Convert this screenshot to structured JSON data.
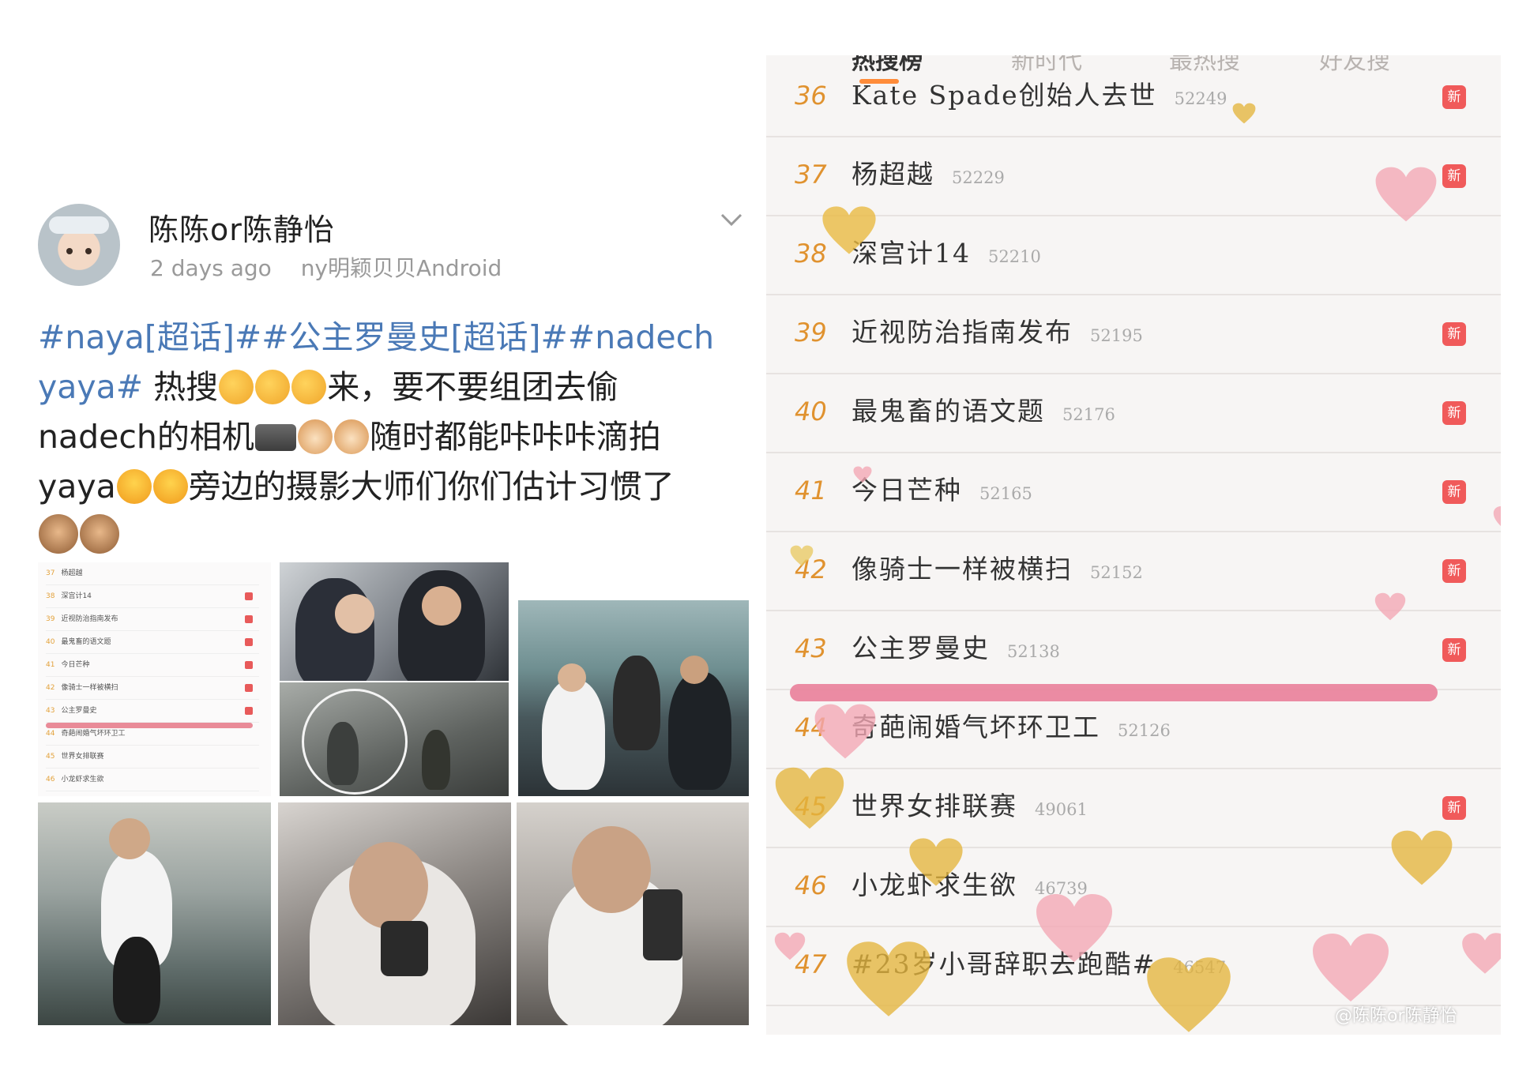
{
  "post": {
    "username": "陈陈or陈静怡",
    "time": "2 days ago",
    "source": "ny明颖贝贝Android",
    "tags": {
      "t1": "#naya[超话]#",
      "t2": "#公主罗曼史[超话]#",
      "t3": "#nadech",
      "t3b": "yaya#"
    },
    "text": {
      "a": " 热搜",
      "b": "来，要不要组团去偷",
      "c": "nadech的相机",
      "d": "随时都能咔咔咔滴拍",
      "e": "yaya",
      "f": "旁边的摄影大师们你们估计习惯了"
    },
    "emoji": [
      "clap-emoji",
      "camera-emoji",
      "cat-emoji",
      "laugh-emoji",
      "see-no-evil-monkey-emoji"
    ],
    "thumbnail_list": [
      {
        "rank": "37",
        "title": "杨超越"
      },
      {
        "rank": "38",
        "title": "深宫计14"
      },
      {
        "rank": "39",
        "title": "近视防治指南发布"
      },
      {
        "rank": "40",
        "title": "最鬼畜的语文题"
      },
      {
        "rank": "41",
        "title": "今日芒种"
      },
      {
        "rank": "42",
        "title": "像骑士一样被横扫"
      },
      {
        "rank": "43",
        "title": "公主罗曼史"
      },
      {
        "rank": "44",
        "title": "奇葩闹婚气坏环卫工"
      },
      {
        "rank": "45",
        "title": "世界女排联赛"
      },
      {
        "rank": "46",
        "title": "小龙虾求生欲"
      }
    ]
  },
  "hot_list": {
    "tabs": [
      "热搜榜",
      "新时代",
      "最热搜",
      "好友搜"
    ],
    "active_tab": "热搜榜",
    "new_label": "新",
    "rows": [
      {
        "rank": "36",
        "title": "Kate Spade创始人去世",
        "count": "52249",
        "is_new": true
      },
      {
        "rank": "37",
        "title": "杨超越",
        "count": "52229",
        "is_new": true
      },
      {
        "rank": "38",
        "title": "深宫计14",
        "count": "52210",
        "is_new": false
      },
      {
        "rank": "39",
        "title": "近视防治指南发布",
        "count": "52195",
        "is_new": true
      },
      {
        "rank": "40",
        "title": "最鬼畜的语文题",
        "count": "52176",
        "is_new": true
      },
      {
        "rank": "41",
        "title": "今日芒种",
        "count": "52165",
        "is_new": true
      },
      {
        "rank": "42",
        "title": "像骑士一样被横扫",
        "count": "52152",
        "is_new": true
      },
      {
        "rank": "43",
        "title": "公主罗曼史",
        "count": "52138",
        "is_new": true
      },
      {
        "rank": "44",
        "title": "奇葩闹婚气坏环卫工",
        "count": "52126",
        "is_new": false
      },
      {
        "rank": "45",
        "title": "世界女排联赛",
        "count": "49061",
        "is_new": true
      },
      {
        "rank": "46",
        "title": "小龙虾求生欲",
        "count": "46739",
        "is_new": false
      },
      {
        "rank": "47",
        "title": "#23岁小哥辞职去跑酷#",
        "count": "46547",
        "is_new": false
      }
    ],
    "watermark": "@陈陈or陈静怡"
  },
  "colors": {
    "tag_blue": "#4a79b6",
    "rank_orange": "#e0922f",
    "badge_red": "#f05a5a",
    "underline_pink": "#e9809a",
    "tab_indicator": "#ff8c3a"
  }
}
